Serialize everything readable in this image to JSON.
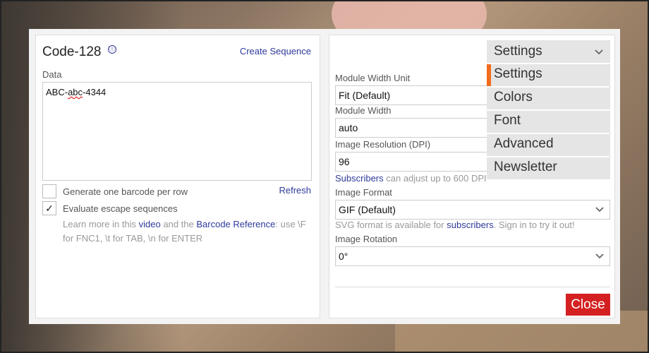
{
  "left_panel": {
    "title": "Code-128",
    "info_icon": "ⓘ",
    "create_sequence": "Create Sequence",
    "data_label": "Data",
    "data_value_part1": "ABC-",
    "data_value_part2": "abc",
    "data_value_part3": "-4344",
    "option_per_row": "Generate one barcode per row",
    "option_per_row_checked": false,
    "refresh": "Refresh",
    "option_escape": "Evaluate escape sequences",
    "option_escape_checked": true,
    "check_mark": "✓",
    "help_learn": "Learn more in this ",
    "help_video": "video",
    "help_and": " and the ",
    "help_reference": "Barcode Reference",
    "help_rest": ": use \\F for FNC1, \\t for TAB, \\n for ENTER"
  },
  "right_panel": {
    "module_width_unit_label": "Module Width Unit",
    "module_width_unit_value": "Fit (Default)",
    "module_width_label": "Module Width",
    "module_width_value": "auto",
    "dpi_label": "Image Resolution (DPI)",
    "dpi_value": "96",
    "dpi_hint_link": "Subscribers",
    "dpi_hint_text": " can adjust up to 600 DPI",
    "format_label": "Image Format",
    "format_value": "GIF (Default)",
    "format_hint_pre": "SVG format is available for ",
    "format_hint_link": "subscribers",
    "format_hint_post": ". Sign in to try it out!",
    "rotation_label": "Image Rotation",
    "rotation_value": "0°",
    "close": "Close"
  },
  "tab_menu": {
    "selected": "Settings",
    "items": [
      "Settings",
      "Colors",
      "Font",
      "Advanced",
      "Newsletter"
    ],
    "active_index": 0
  },
  "colors": {
    "accent": "#f26b1d",
    "close_button": "#d42020",
    "link": "#2e3a9a"
  }
}
